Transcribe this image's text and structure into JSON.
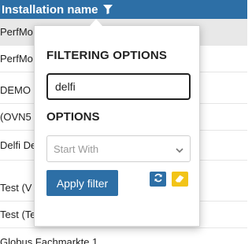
{
  "header": {
    "column_title": "Installation name",
    "filter_icon": "filter-icon"
  },
  "rows": [
    {
      "label": "PerfMo"
    },
    {
      "label": "PerfMo"
    },
    {
      "label": "DEMO"
    },
    {
      "label": "(OVN5"
    },
    {
      "label": "Delfi De"
    },
    {
      "label": "Test (V"
    },
    {
      "label": "Test (Te"
    },
    {
      "label": "Globus Fachmarkte 1"
    }
  ],
  "popup": {
    "filtering_title": "FILTERING OPTIONS",
    "filter_value": "delfi",
    "options_title": "OPTIONS",
    "match_mode_selected": "Start With",
    "apply_label": "Apply filter",
    "reset_icon": "refresh-icon",
    "clear_icon": "eraser-icon"
  },
  "colors": {
    "accent": "#2d6fa6",
    "warning": "#f2c418"
  }
}
